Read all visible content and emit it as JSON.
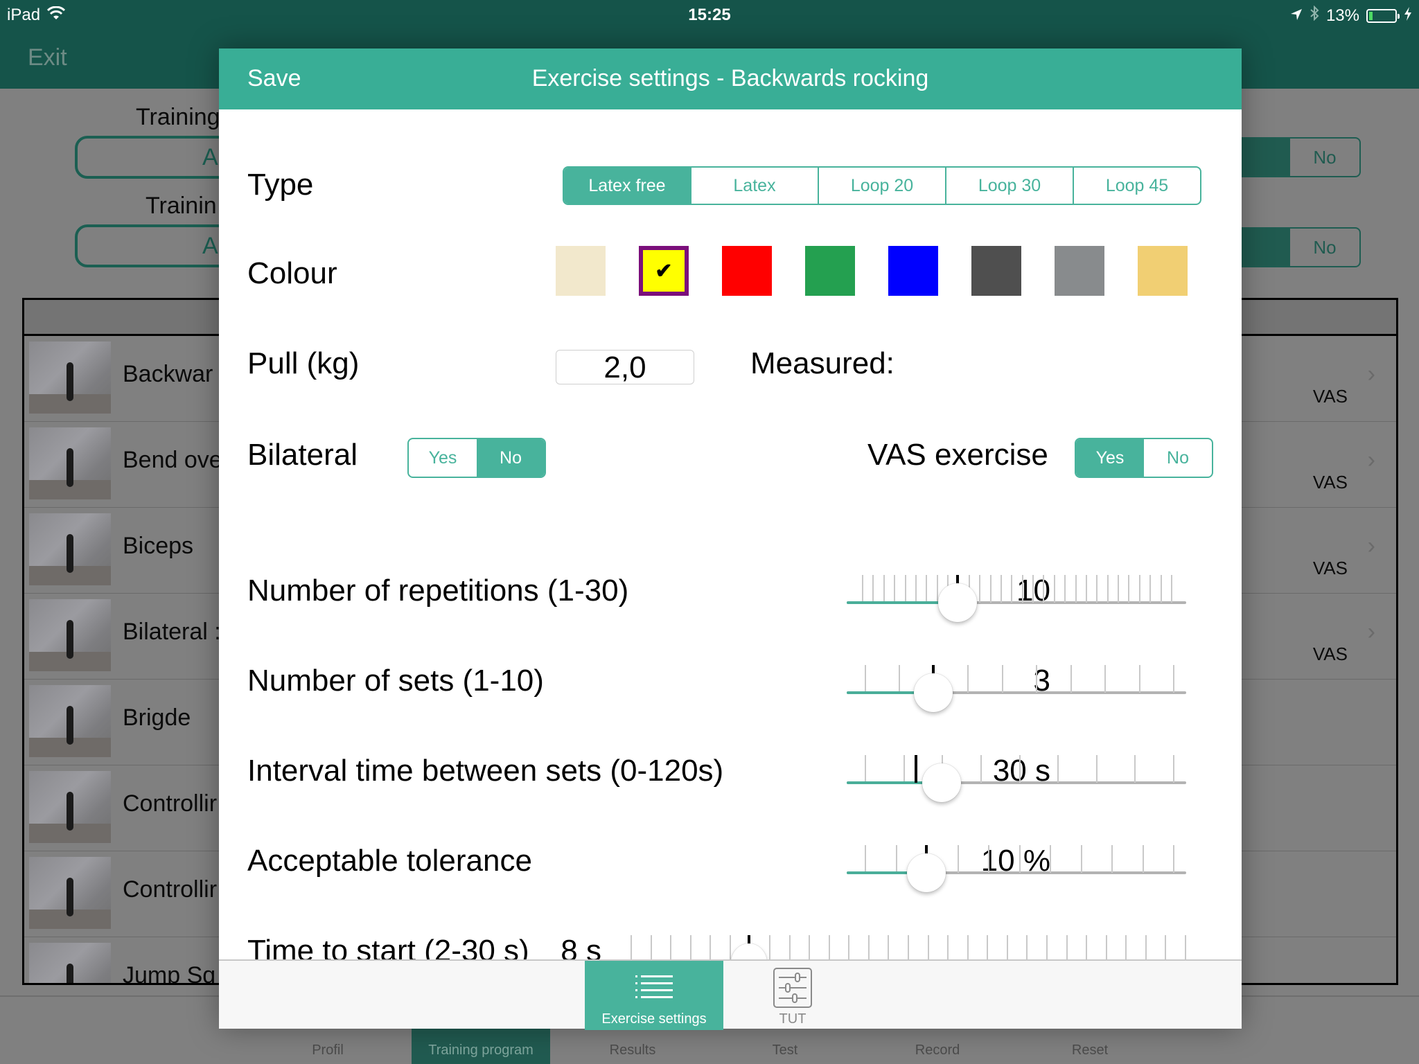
{
  "status_bar": {
    "device": "iPad",
    "time": "15:25",
    "battery_percent": "13%",
    "icons": [
      "wifi-icon",
      "location-arrow-icon",
      "bluetooth-icon",
      "battery-icon",
      "charging-bolt-icon"
    ]
  },
  "background": {
    "nav": {
      "exit_label": "Exit"
    },
    "filters": [
      {
        "label": "Training",
        "value": "Al",
        "toggle_off_label": "No"
      },
      {
        "label": "Trainin",
        "value": "Al",
        "toggle_off_label": "No"
      }
    ],
    "exercises": [
      {
        "name": "Backwar",
        "tag": "VAS"
      },
      {
        "name": "Bend ove",
        "tag": "VAS"
      },
      {
        "name": "Biceps",
        "tag": "VAS"
      },
      {
        "name": "Bilateral :",
        "tag": "VAS"
      },
      {
        "name": "Brigde",
        "tag": ""
      },
      {
        "name": "Controllir",
        "tag": ""
      },
      {
        "name": "Controllir",
        "tag": ""
      },
      {
        "name": "Jump Sq",
        "tag": ""
      }
    ],
    "tabbar": [
      {
        "label": "Profil",
        "icon": "person-icon",
        "active": false
      },
      {
        "label": "Training program",
        "icon": "list-icon",
        "active": true
      },
      {
        "label": "Results",
        "icon": "chart-icon",
        "active": false
      },
      {
        "label": "Test",
        "icon": "gauge-icon",
        "active": false
      },
      {
        "label": "Record",
        "icon": "record-icon",
        "active": false
      },
      {
        "label": "Reset",
        "icon": "trash-icon",
        "active": false
      }
    ]
  },
  "modal": {
    "save_label": "Save",
    "title": "Exercise settings - Backwards rocking",
    "type": {
      "label": "Type",
      "options": [
        "Latex free",
        "Latex",
        "Loop 20",
        "Loop 30",
        "Loop 45"
      ],
      "selected": "Latex free"
    },
    "colour": {
      "label": "Colour",
      "swatches": [
        "#f2e8cc",
        "#ffff00",
        "#ff0000",
        "#24a050",
        "#0000ff",
        "#4f4f4f",
        "#888b8d",
        "#f1cf73"
      ],
      "selected_index": 1,
      "selected_border": "#7b0f7b",
      "check_glyph": "✔"
    },
    "pull": {
      "label": "Pull (kg)",
      "value": "2,0",
      "measured_label": "Measured:"
    },
    "bilateral": {
      "label": "Bilateral",
      "yes": "Yes",
      "no": "No",
      "selected": "No"
    },
    "vas_exercise": {
      "label": "VAS exercise",
      "yes": "Yes",
      "no": "No",
      "selected": "Yes"
    },
    "sliders": [
      {
        "label": "Number of repetitions (1-30)",
        "display": "10",
        "min": 1,
        "max": 30,
        "value": 10,
        "marker": 10
      },
      {
        "label": "Number of sets (1-10)",
        "display": "3",
        "min": 1,
        "max": 10,
        "value": 3,
        "marker": 3
      },
      {
        "label": "Interval time between sets (0-120s)",
        "display": "30 s",
        "min": 0,
        "max": 120,
        "value": 30,
        "marker": 20
      },
      {
        "label": "Acceptable tolerance",
        "display": "10 %",
        "min": 0,
        "max": 50,
        "value": 10,
        "marker": 10
      },
      {
        "label": "Time to start (2-30 s)",
        "display": "8 s",
        "min": 2,
        "max": 30,
        "value": 8,
        "marker": 8
      }
    ],
    "footer_tabs": [
      {
        "label": "Exercise settings",
        "icon": "list-icon",
        "active": true
      },
      {
        "label": "TUT",
        "icon": "sliders-icon",
        "active": false
      }
    ]
  },
  "colors": {
    "accent": "#39ae96",
    "dark_header": "#15544a",
    "slider_fill": "#4aae99"
  }
}
